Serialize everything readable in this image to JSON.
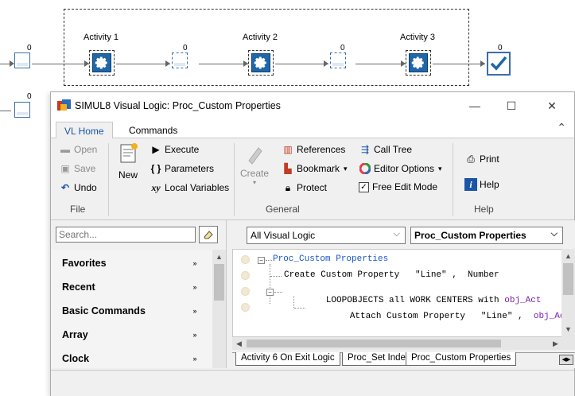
{
  "canvas": {
    "queues": [
      {
        "id": "q-row1-start",
        "count": "0"
      },
      {
        "id": "q-1-2",
        "count": "0"
      },
      {
        "id": "q-2-3",
        "count": "0"
      },
      {
        "id": "q-end",
        "count": "0"
      },
      {
        "id": "q-row2-start",
        "count": "0"
      }
    ],
    "activities": [
      {
        "label": "Activity 1"
      },
      {
        "label": "Activity 2"
      },
      {
        "label": "Activity 3"
      }
    ]
  },
  "window": {
    "title": "SIMUL8 Visual Logic: Proc_Custom Properties",
    "controls": {
      "minimize": "—",
      "maximize": "☐",
      "close": "✕"
    }
  },
  "ribbon_tabs": [
    {
      "label": "VL Home",
      "active": true
    },
    {
      "label": "Commands",
      "active": false
    }
  ],
  "ribbon": {
    "file": {
      "open": "Open",
      "save": "Save",
      "undo": "Undo",
      "group": "File"
    },
    "new": "New",
    "general": {
      "execute": "Execute",
      "parameters": "Parameters",
      "local_variables": "Local Variables",
      "create": "Create",
      "references": "References",
      "bookmark": "Bookmark",
      "protect": "Protect",
      "call_tree": "Call Tree",
      "editor_options": "Editor Options",
      "free_edit_mode": "Free Edit Mode",
      "free_edit_checked": true,
      "group": "General"
    },
    "help": {
      "print": "Print",
      "help": "Help",
      "group": "Help"
    }
  },
  "left_panel": {
    "search_placeholder": "Search...",
    "categories": [
      "Favorites",
      "Recent",
      "Basic Commands",
      "Array",
      "Clock"
    ]
  },
  "right_panel": {
    "logic_filter": "All Visual Logic",
    "logic_selected": "Proc_Custom Properties",
    "code_lines": [
      {
        "parts": [
          {
            "text": "Proc_Custom Properties",
            "color": "#1a55d0"
          }
        ]
      },
      {
        "parts": [
          {
            "text": "Create Custom Property   \"Line\" ,  Number",
            "color": "#000000"
          }
        ]
      },
      {
        "parts": [
          {
            "text": "LOOPOBJECTS all WORK CENTERS with ",
            "color": "#000000"
          },
          {
            "text": "obj_Act",
            "color": "#7a1fb0"
          }
        ]
      },
      {
        "parts": [
          {
            "text": "Attach Custom Property   \"Line\" ,  ",
            "color": "#000000"
          },
          {
            "text": "obj_Act",
            "color": "#7a1fb0"
          }
        ]
      }
    ],
    "sheet_tabs": [
      "Activity 6 On Exit Logic",
      "Proc_Set Index",
      "Proc_Custom Properties"
    ],
    "active_sheet": "Proc_Custom Properties"
  },
  "colors": {
    "accent": "#1a55a8",
    "keyword_object": "#7a1fb0",
    "logic_name": "#1a55d0",
    "work_center": "#1f67a8"
  }
}
